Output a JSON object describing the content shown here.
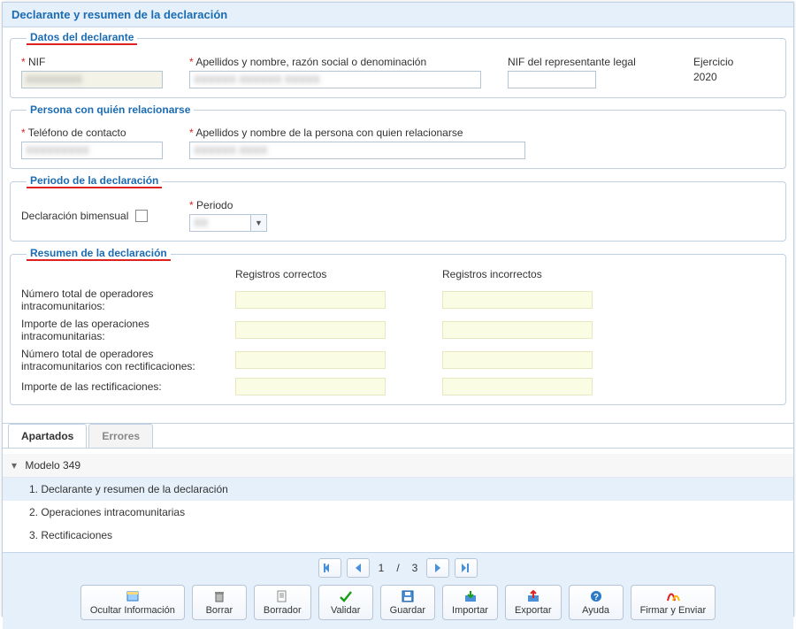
{
  "header": {
    "title": "Declarante y resumen de la declaración"
  },
  "section_datos": {
    "legend": "Datos del declarante",
    "nif_label": "NIF",
    "nif_value": "XXXXXXXX",
    "apell_label": "Apellidos y nombre, razón social o denominación",
    "apell_value": "XXXXXX XXXXXX XXXXX",
    "nif_rep_label": "NIF del representante legal",
    "nif_rep_value": "",
    "ejercicio_label": "Ejercicio",
    "ejercicio_value": "2020"
  },
  "section_persona": {
    "legend": "Persona con quién relacionarse",
    "tel_label": "Teléfono de contacto",
    "tel_value": "XXXXXXXXX",
    "apell_label": "Apellidos y nombre de la persona con quien relacionarse",
    "apell_value": "XXXXXX XXXX"
  },
  "section_periodo": {
    "legend": "Periodo de la declaración",
    "bimensual_label": "Declaración bimensual",
    "bimensual_checked": false,
    "periodo_label": "Periodo",
    "periodo_value": "XX"
  },
  "section_resumen": {
    "legend": "Resumen de la declaración",
    "col_correct": "Registros correctos",
    "col_incorrect": "Registros incorrectos",
    "rows": [
      "Número total de operadores intracomunitarios:",
      "Importe de las operaciones intracomunitarias:",
      "Número total de operadores intracomunitarios con rectificaciones:",
      "Importe de las rectificaciones:"
    ]
  },
  "tabs": {
    "apartados": "Apartados",
    "errores": "Errores"
  },
  "tree": {
    "root": "Modelo 349",
    "items": [
      "1. Declarante y resumen de la declaración",
      "2. Operaciones intracomunitarias",
      "3. Rectificaciones"
    ],
    "selected_index": 0
  },
  "pager": {
    "current": "1",
    "sep": " / ",
    "total": "3"
  },
  "toolbar": {
    "hide": "Ocultar Información",
    "delete": "Borrar",
    "draft": "Borrador",
    "validate": "Validar",
    "save": "Guardar",
    "import": "Importar",
    "export": "Exportar",
    "help": "Ayuda",
    "sign": "Firmar y Enviar"
  }
}
